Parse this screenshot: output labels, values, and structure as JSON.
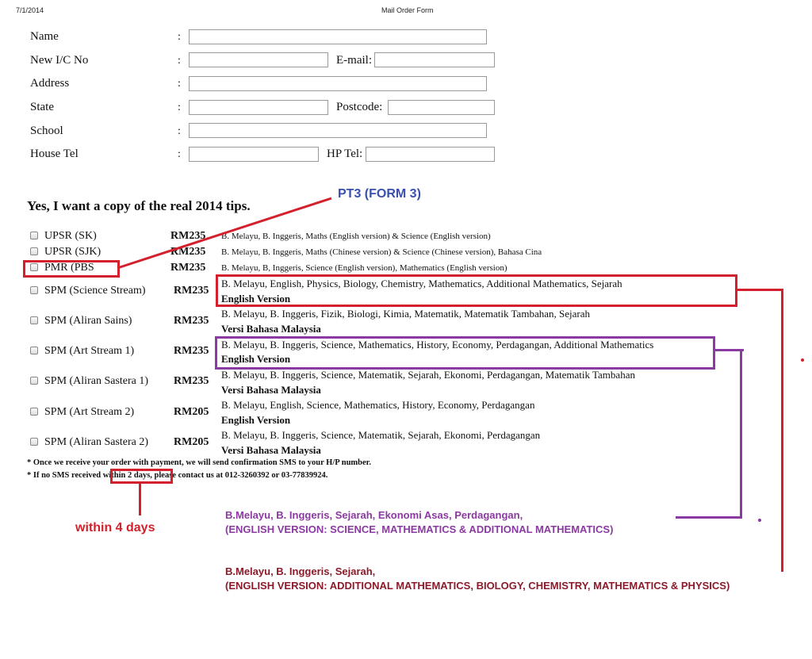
{
  "header": {
    "date": "7/1/2014",
    "title": "Mail Order Form"
  },
  "form": {
    "colon": ":",
    "name_label": "Name",
    "ic_label": "New I/C No",
    "email_label": "E-mail:",
    "address_label": "Address",
    "state_label": "State",
    "postcode_label": "Postcode:",
    "school_label": "School",
    "house_tel_label": "House Tel",
    "hp_tel_label": "HP Tel:"
  },
  "heading": "Yes, I want a copy of the real 2014 tips.",
  "products": [
    {
      "name": "UPSR (SK)",
      "price": "RM235",
      "subjects": "B. Melayu, B. Inggeris, Maths (English version) & Science (English version)",
      "version": ""
    },
    {
      "name": "UPSR (SJK)",
      "price": "RM235",
      "subjects": "B. Melayu, B. Inggeris, Maths (Chinese version) & Science (Chinese version), Bahasa Cina",
      "version": ""
    },
    {
      "name": "PMR (PBS",
      "price": "RM235",
      "subjects": "B. Melayu, B, Inggeris, Science (English version), Mathematics (English version)",
      "version": ""
    },
    {
      "name": "SPM (Science Stream)",
      "price": "RM235",
      "subjects": "B. Melayu, English, Physics, Biology, Chemistry, Mathematics, Additional Mathematics, Sejarah",
      "version": "English Version"
    },
    {
      "name": "SPM (Aliran Sains)",
      "price": "RM235",
      "subjects": "B. Melayu, B. Inggeris, Fizik, Biologi, Kimia, Matematik, Matematik Tambahan, Sejarah",
      "version": "Versi Bahasa Malaysia"
    },
    {
      "name": "SPM (Art Stream 1)",
      "price": "RM235",
      "subjects": "B. Melayu, B. Inggeris, Science, Mathematics, History, Economy, Perdagangan, Additional Mathematics",
      "version": "English Version"
    },
    {
      "name": "SPM (Aliran Sastera 1)",
      "price": "RM235",
      "subjects": "B. Melayu, B. Inggeris, Science, Matematik, Sejarah, Ekonomi, Perdagangan, Matematik Tambahan",
      "version": "Versi Bahasa Malaysia"
    },
    {
      "name": "SPM (Art Stream 2)",
      "price": "RM205",
      "subjects": "B. Melayu, English, Science, Mathematics, History, Economy, Perdagangan",
      "version": "English Version"
    },
    {
      "name": "SPM (Aliran Sastera 2)",
      "price": "RM205",
      "subjects": "B. Melayu, B. Inggeris, Science, Matematik, Sejarah, Ekonomi, Perdagangan",
      "version": "Versi Bahasa Malaysia"
    }
  ],
  "notes": {
    "line1": "* Once we receive your order with payment, we will send confirmation SMS to your H/P number.",
    "line2_pre": "* If no SMS received ",
    "line2_highlight": "within 2 days,",
    "line2_post": " please contact us at 012-3260392 or 03-77839924."
  },
  "annotations": {
    "pt3": "PT3 (FORM 3)",
    "within": "within 4 days",
    "art_line1": "B.Melayu, B. Inggeris, Sejarah, Ekonomi Asas, Perdagangan,",
    "art_line2": "(ENGLISH VERSION: SCIENCE, MATHEMATICS & ADDITIONAL MATHEMATICS)",
    "sci_line1": "B.Melayu, B. Inggeris, Sejarah,",
    "sci_line2": "(ENGLISH VERSION: ADDITIONAL MATHEMATICS, BIOLOGY, CHEMISTRY, MATHEMATICS & PHYSICS)"
  },
  "colors": {
    "red": "#d4202c",
    "purple": "#8a3aa0",
    "blue": "#3a4fb0",
    "dark_red": "#8b1a2a"
  }
}
